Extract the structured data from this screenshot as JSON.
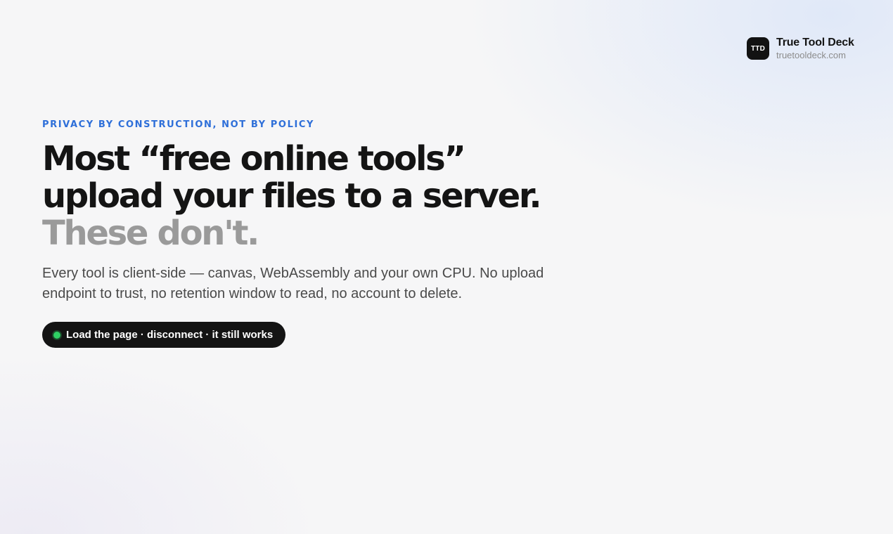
{
  "brand": {
    "mark": "TTD",
    "name": "True Tool Deck",
    "domain": "truetooldeck.com"
  },
  "hero": {
    "eyebrow": "PRIVACY BY CONSTRUCTION, NOT BY POLICY",
    "headline_line_1": "Most “free online tools”",
    "headline_line_2": "upload your files to a server.",
    "headline_line_3": "These don't.",
    "lede": "Every tool is client-side — canvas, WebAssembly and your own CPU. No upload endpoint to trust, no retention window to read, no account to delete."
  },
  "status_pill": {
    "label": "Load the page · disconnect · it still works",
    "icon": "status-dot-icon",
    "dot_color": "#2fd064"
  },
  "colors": {
    "accent": "#2e6fd9",
    "text": "#141414",
    "muted_text": "#9a9a9a"
  }
}
